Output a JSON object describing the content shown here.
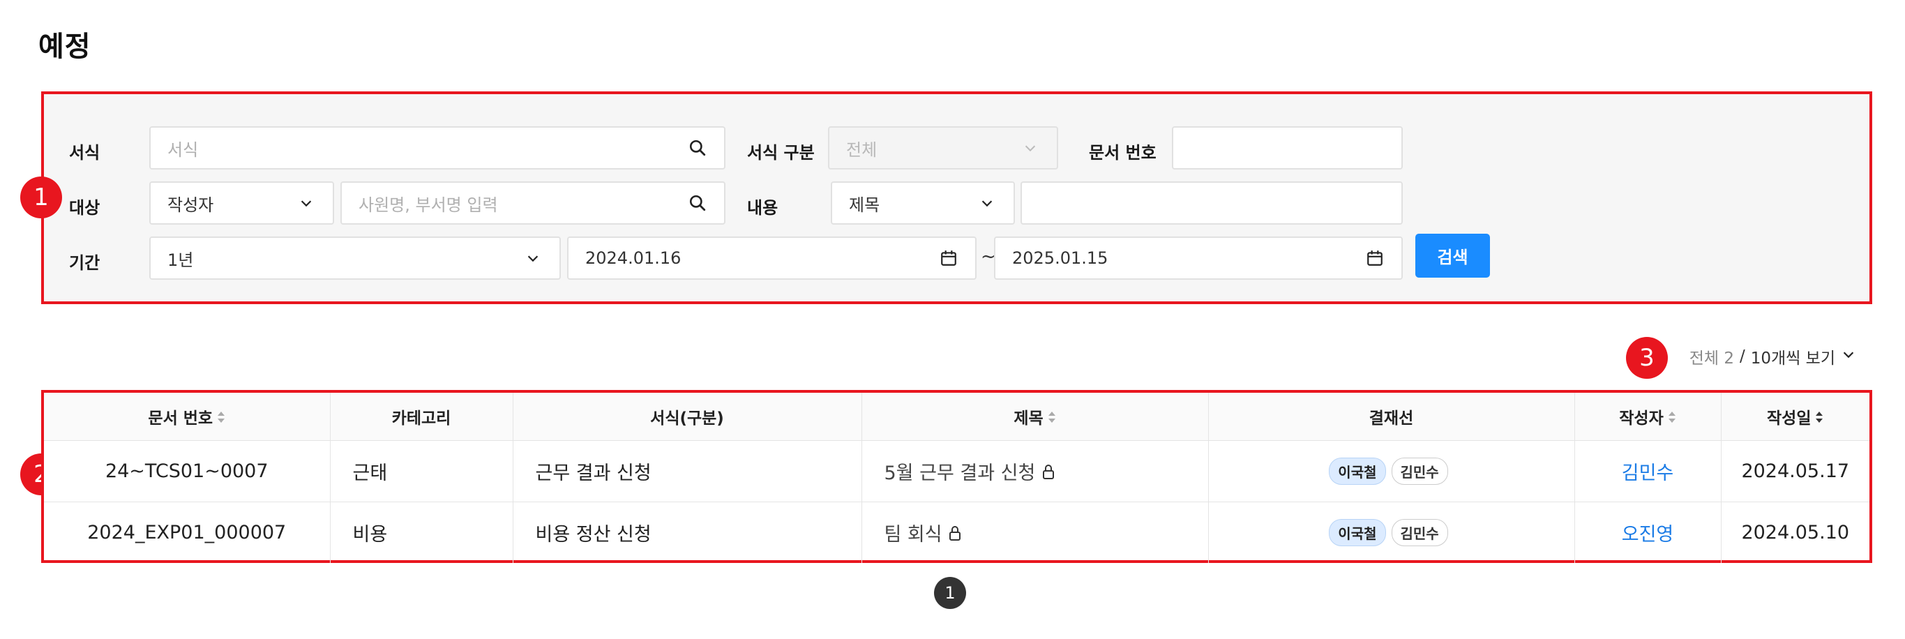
{
  "page": {
    "title": "예정"
  },
  "search": {
    "form_label": "서식",
    "form_placeholder": "서식",
    "form_type_label": "서식 구분",
    "form_type_value": "전체",
    "doc_number_label": "문서 번호",
    "doc_number_value": "",
    "target_label": "대상",
    "target_value": "작성자",
    "target_placeholder": "사원명, 부서명 입력",
    "content_label": "내용",
    "content_value": "제목",
    "content_input_value": "",
    "period_label": "기간",
    "period_value": "1년",
    "date_start": "2024.01.16",
    "date_end": "2025.01.15",
    "date_separator": "~",
    "search_button": "검색"
  },
  "badges": {
    "search_area": "1",
    "table_area": "2",
    "summary_area": "3"
  },
  "summary": {
    "total_label": "전체 2",
    "separator": " / ",
    "per_page": "10개씩 보기"
  },
  "table": {
    "headers": {
      "doc_number": "문서 번호",
      "category": "카테고리",
      "form": "서식(구분)",
      "title": "제목",
      "approval_line": "결재선",
      "author": "작성자",
      "date": "작성일"
    },
    "rows": [
      {
        "doc_number": "24~TCS01~0007",
        "category": "근태",
        "form": "근무 결과 신청",
        "title": "5월 근무 결과 신청",
        "approver_1": "이국철",
        "approver_2": "김민수",
        "author": "김민수",
        "date": "2024.05.17"
      },
      {
        "doc_number": "2024_EXP01_000007",
        "category": "비용",
        "form": "비용 정산 신청",
        "title": "팀 회식",
        "approver_1": "이국철",
        "approver_2": "김민수",
        "author": "오진영",
        "date": "2024.05.10"
      }
    ]
  },
  "pagination": {
    "current": "1"
  },
  "colors": {
    "accent": "#1a8cff",
    "highlight_border": "#e8161f",
    "link": "#1a7be6"
  }
}
